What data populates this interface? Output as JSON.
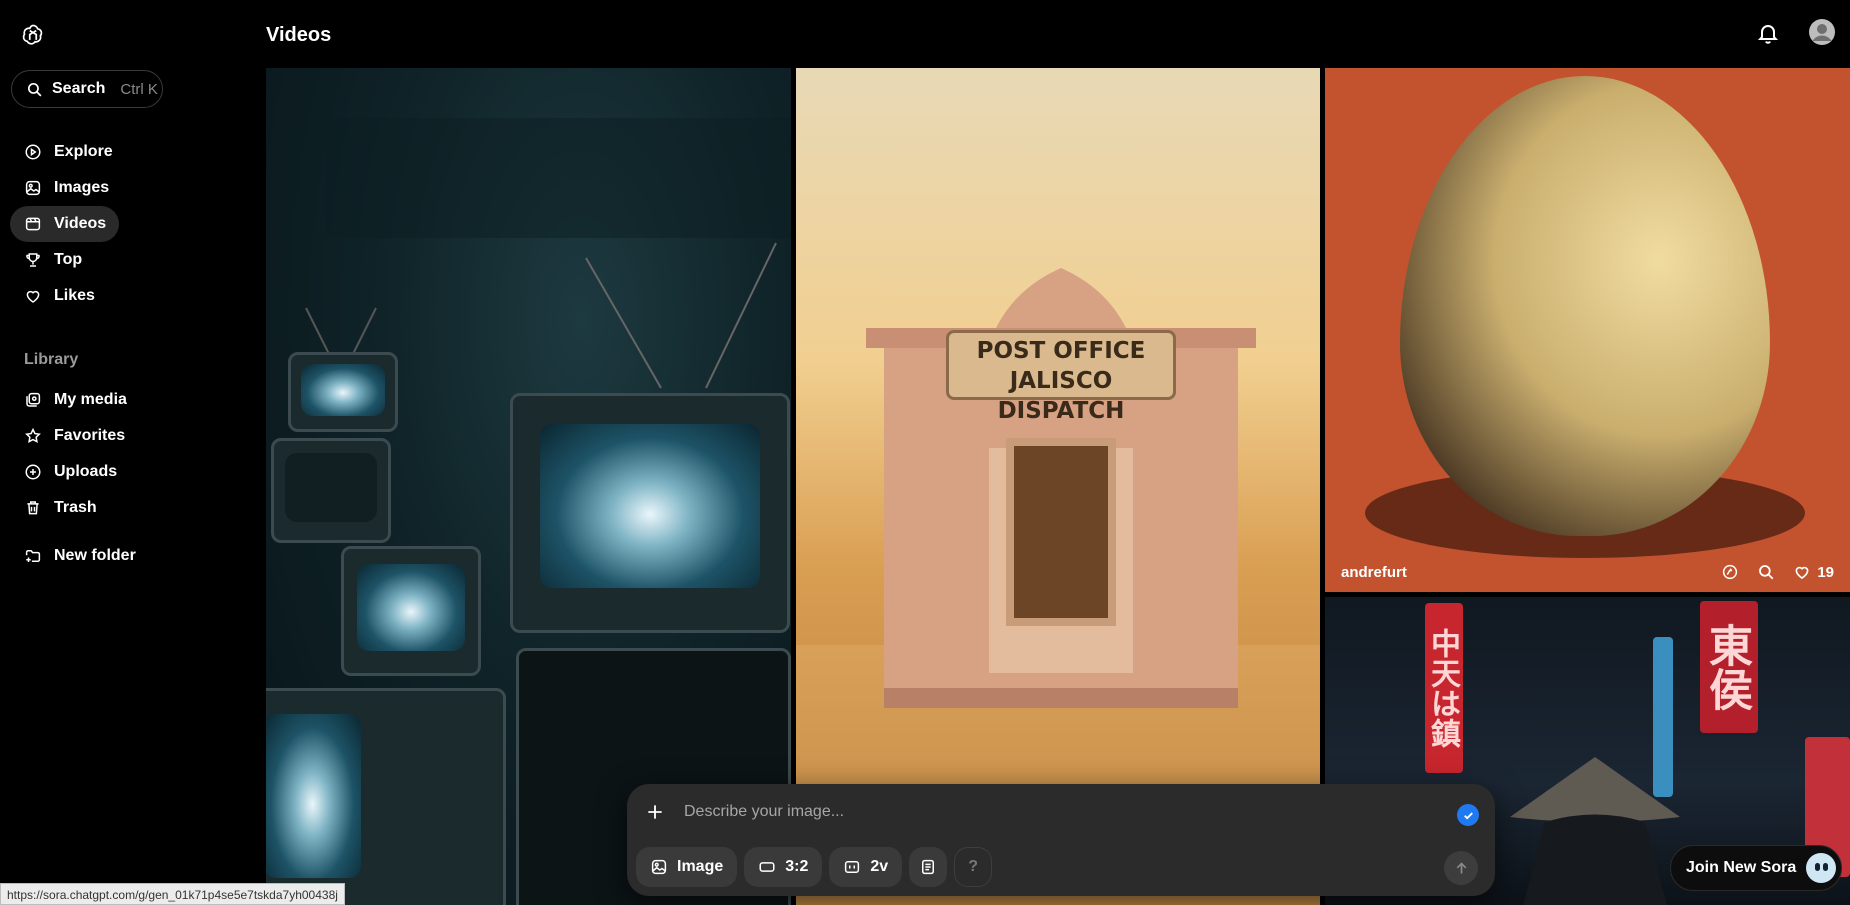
{
  "header": {
    "title": "Videos"
  },
  "search": {
    "label": "Search",
    "shortcut": "Ctrl K"
  },
  "nav": {
    "items": [
      {
        "label": "Explore",
        "icon": "explore-icon"
      },
      {
        "label": "Images",
        "icon": "images-icon"
      },
      {
        "label": "Videos",
        "icon": "videos-icon",
        "active": true
      },
      {
        "label": "Top",
        "icon": "trophy-icon"
      },
      {
        "label": "Likes",
        "icon": "heart-icon"
      }
    ]
  },
  "library": {
    "label": "Library",
    "items": [
      {
        "label": "My media",
        "icon": "media-icon"
      },
      {
        "label": "Favorites",
        "icon": "star-icon"
      },
      {
        "label": "Uploads",
        "icon": "upload-icon"
      },
      {
        "label": "Trash",
        "icon": "trash-icon"
      }
    ],
    "new_folder": "New folder"
  },
  "tiles": {
    "post_office_sign": {
      "line1": "POST OFFICE",
      "line2": "JALISCO DISPATCH"
    },
    "egg": {
      "author": "andrefurt",
      "likes": "19"
    },
    "rain_signs": {
      "left": "中天は鎮",
      "right": "東侯"
    }
  },
  "composer": {
    "placeholder": "Describe your image...",
    "chips": {
      "type": "Image",
      "ratio": "3:2",
      "variations": "2v",
      "help": "?"
    }
  },
  "join": {
    "label": "Join New Sora"
  },
  "status_bar": {
    "url": "https://sora.chatgpt.com/g/gen_01k71p4se5e7tskda7yh00438j"
  },
  "colors": {
    "accent": "#1f7af2",
    "background": "#000000",
    "active_nav": "#2a2a2a"
  }
}
